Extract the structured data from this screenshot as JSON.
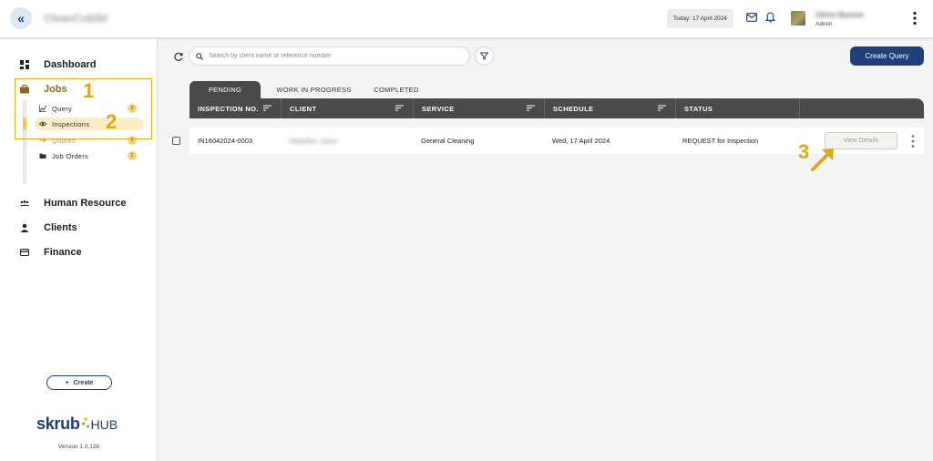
{
  "header": {
    "company_name": "CleanCubibl",
    "date_chip": "Today: 17 April 2024",
    "user_name": "Ghinn Bonnet",
    "user_role": "Admin"
  },
  "sidebar": {
    "nav": [
      {
        "label": "Dashboard"
      },
      {
        "label": "Jobs"
      },
      {
        "label": "Human Resource"
      },
      {
        "label": "Clients"
      },
      {
        "label": "Finance"
      }
    ],
    "jobs_sub": [
      {
        "label": "Query",
        "count": "3"
      },
      {
        "label": "Inspections",
        "count": ""
      },
      {
        "label": "Quotes",
        "count": "1"
      },
      {
        "label": "Job Orders",
        "count": "1"
      }
    ],
    "create_label": "Create",
    "logo_left": "skrub",
    "logo_right": "HUB",
    "version": "Version 1.0.126"
  },
  "toolbar": {
    "search_placeholder": "Search by client name or reference number",
    "create_query_label": "Create Query"
  },
  "tabs": [
    {
      "label": "PENDING"
    },
    {
      "label": "WORK IN PROGRESS"
    },
    {
      "label": "COMPLETED"
    }
  ],
  "table": {
    "columns": [
      "INSPECTION NO.",
      "CLIENT",
      "SERVICE",
      "SCHEDULE",
      "STATUS"
    ],
    "rows": [
      {
        "inspection_no": "IN16042024-0003",
        "client": "Magellan Japan",
        "service": "General Cleaning",
        "schedule": "Wed, 17 April 2024",
        "status": "REQUEST for Inspection",
        "action": "View Details"
      }
    ]
  },
  "annotations": [
    "1",
    "2",
    "3"
  ],
  "colors": {
    "brand": "#1f3f7a",
    "highlight": "#e1ad1b",
    "table_header": "#4a4a4a",
    "active_sub": "#fbeec5"
  }
}
